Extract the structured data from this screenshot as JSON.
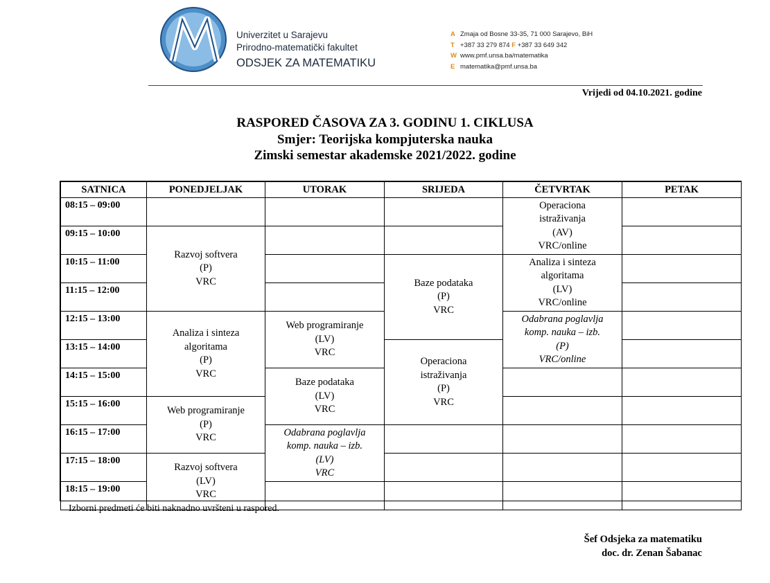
{
  "header": {
    "university": "Univerzitet u Sarajevu",
    "faculty": "Prirodno-matematički fakultet",
    "department": "ODSJEK ZA MATEMATIKU",
    "contact": {
      "a_key": "A",
      "address": "Zmaja od Bosne 33-35, 71 000 Sarajevo, BiH",
      "t_key": "T",
      "phone": "+387 33 279 874",
      "f_key": "F",
      "fax": "+387 33 649 342",
      "w_key": "W",
      "web": "www.pmf.unsa.ba/matematika",
      "e_key": "E",
      "email": "matematika@pmf.unsa.ba"
    },
    "logo_icon": "pmf-m-logo-icon"
  },
  "valid_from": "Vrijedi od 04.10.2021. godine",
  "title": {
    "line1": "RASPORED ČASOVA ZA 3. GODINU 1. CIKLUSA",
    "line2": "Smjer: Teorijska kompjuterska nauka",
    "line3": "Zimski semestar akademske 2021/2022. godine"
  },
  "table": {
    "headers": [
      "SATNICA",
      "PONEDJELJAK",
      "UTORAK",
      "SRIJEDA",
      "ČETVRTAK",
      "PETAK"
    ],
    "times": [
      "08:15 – 09:00",
      "09:15 – 10:00",
      "10:15 – 11:00",
      "11:15 – 12:00",
      "12:15 – 13:00",
      "13:15 – 14:00",
      "14:15 – 15:00",
      "15:15 – 16:00",
      "16:15 – 17:00",
      "17:15 – 18:00",
      "18:15 – 19:00"
    ],
    "mon": {
      "razvoj_p": [
        "Razvoj softvera",
        "(P)",
        "VRC"
      ],
      "analiza_p": [
        "Analiza i sinteza",
        "algoritama",
        "(P)",
        "VRC"
      ],
      "web_p": [
        "Web programiranje",
        "(P)",
        "VRC"
      ],
      "razvoj_lv": [
        "Razvoj softvera",
        "(LV)",
        "VRC"
      ]
    },
    "tue": {
      "web_lv": [
        "Web programiranje",
        "(LV)",
        "VRC"
      ],
      "baze_lv": [
        "Baze podataka",
        "(LV)",
        "VRC"
      ],
      "odabrana_lv": [
        "Odabrana poglavlja",
        "komp. nauka – izb.",
        "(LV)",
        "VRC"
      ]
    },
    "wed": {
      "baze_p": [
        "Baze podataka",
        "(P)",
        "VRC"
      ],
      "operaciona_p": [
        "Operaciona",
        "istraživanja",
        "(P)",
        "VRC"
      ]
    },
    "thu": {
      "operaciona_av": [
        "Operaciona",
        "istraživanja",
        "(AV)",
        "VRC/online"
      ],
      "analiza_lv": [
        "Analiza i sinteza",
        "algoritama",
        "(LV)",
        "VRC/online"
      ],
      "odabrana_p": [
        "Odabrana poglavlja",
        "komp. nauka – izb.",
        "(P)",
        "VRC/online"
      ]
    }
  },
  "note": "Izborni predmeti će biti naknadno uvršteni u raspored.",
  "signature": {
    "role": "Šef Odsjeka za matematiku",
    "name": "doc. dr. Zenan Šabanac"
  }
}
